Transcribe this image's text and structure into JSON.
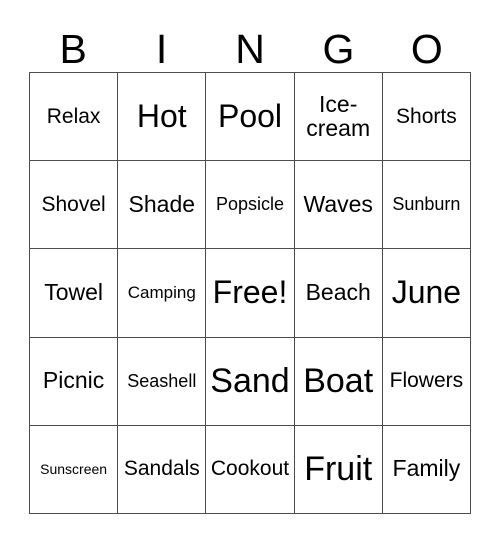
{
  "header": {
    "letters": [
      "B",
      "I",
      "N",
      "G",
      "O"
    ]
  },
  "grid": {
    "columns": 5,
    "rows": 5,
    "cells": [
      {
        "text": "Relax",
        "size": "md"
      },
      {
        "text": "Hot",
        "size": "xxl"
      },
      {
        "text": "Pool",
        "size": "xxl"
      },
      {
        "text": "Ice-cream",
        "size": "mdp"
      },
      {
        "text": "Shorts",
        "size": "md"
      },
      {
        "text": "Shovel",
        "size": "md"
      },
      {
        "text": "Shade",
        "size": "mdp"
      },
      {
        "text": "Popsicle",
        "size": "smp"
      },
      {
        "text": "Waves",
        "size": "mdp"
      },
      {
        "text": "Sunburn",
        "size": "smp"
      },
      {
        "text": "Towel",
        "size": "mdp"
      },
      {
        "text": "Camping",
        "size": "sm"
      },
      {
        "text": "Free!",
        "size": "xxl"
      },
      {
        "text": "Beach",
        "size": "mdp"
      },
      {
        "text": "June",
        "size": "xxl"
      },
      {
        "text": "Picnic",
        "size": "mdp"
      },
      {
        "text": "Seashell",
        "size": "smp"
      },
      {
        "text": "Sand",
        "size": "xxxl"
      },
      {
        "text": "Boat",
        "size": "xxxl"
      },
      {
        "text": "Flowers",
        "size": "md"
      },
      {
        "text": "Sunscreen",
        "size": "xs"
      },
      {
        "text": "Sandals",
        "size": "md"
      },
      {
        "text": "Cookout",
        "size": "md"
      },
      {
        "text": "Fruit",
        "size": "xxxl"
      },
      {
        "text": "Family",
        "size": "mdp"
      }
    ]
  },
  "colors": {
    "background": "#ffffff",
    "text": "#000000",
    "border": "#4d4d4d"
  }
}
